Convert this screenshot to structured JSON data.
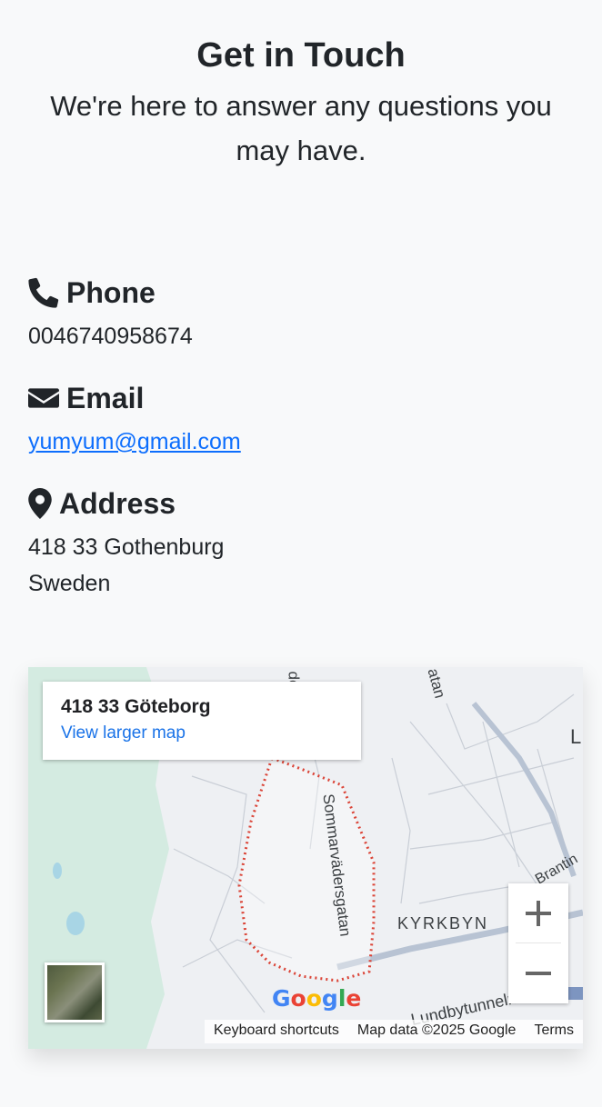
{
  "header": {
    "title": "Get in Touch",
    "subtitle": "We're here to answer any questions you may have."
  },
  "contact": {
    "phone": {
      "label": "Phone",
      "value": "0046740958674",
      "icon": "phone-icon"
    },
    "email": {
      "label": "Email",
      "value": "yumyum@gmail.com",
      "icon": "envelope-icon"
    },
    "address": {
      "label": "Address",
      "line1": "418 33 Gothenburg",
      "line2": "Sweden",
      "icon": "map-marker-icon"
    }
  },
  "map": {
    "place_name": "418 33 Göteborg",
    "view_larger": "View larger map",
    "labels": {
      "street": "Sommarvädersgatan",
      "district": "KYRKBYN",
      "tunnel": "Lundbytunneln",
      "brantingsgatan": "Brantin",
      "top_label_1": "de",
      "top_label_2": "atan",
      "edge_letter": "L"
    },
    "google_logo": "Google",
    "attribution": {
      "keyboard": "Keyboard shortcuts",
      "data": "Map data ©2025 Google",
      "terms": "Terms"
    },
    "zoom_in": "+",
    "zoom_out": "−",
    "colors": {
      "water": "#d4ebe1",
      "boundary": "#db4437",
      "link": "#1a73e8"
    }
  }
}
